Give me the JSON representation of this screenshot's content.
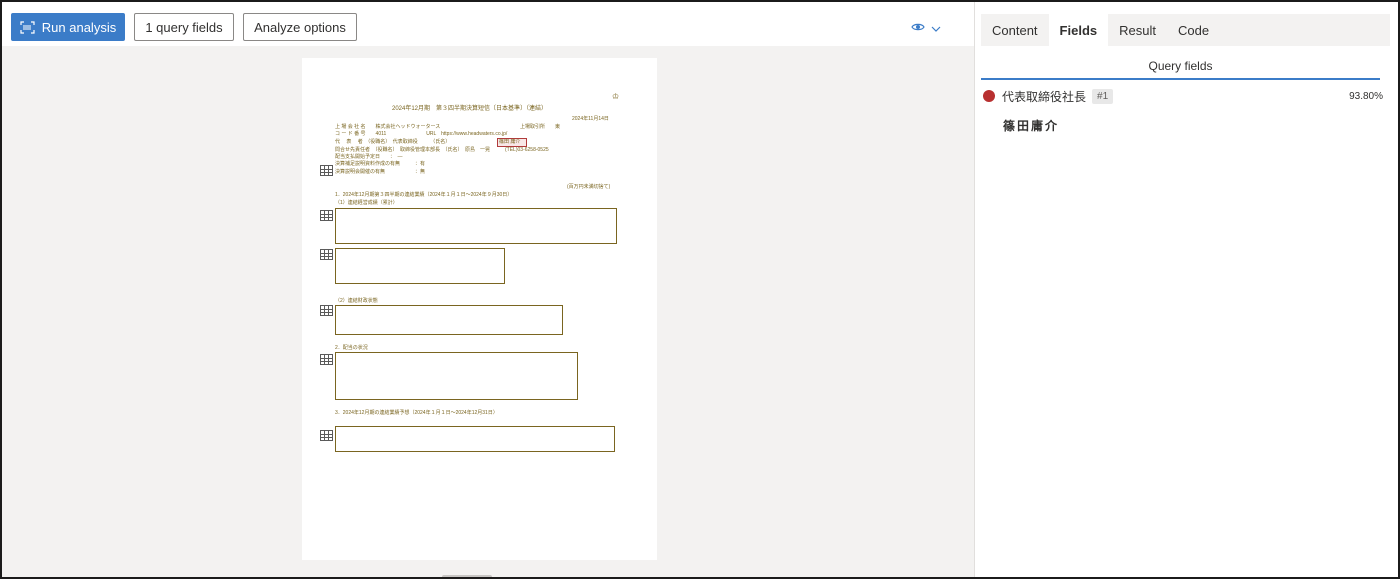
{
  "toolbar": {
    "run_label": "Run analysis",
    "query_label": "1 query fields",
    "analyze_label": "Analyze options"
  },
  "panel": {
    "tabs": [
      "Content",
      "Fields",
      "Result",
      "Code"
    ],
    "active_tab": "Fields",
    "section_title": "Query fields",
    "field": {
      "name": "代表取締役社長",
      "badge": "#1",
      "confidence": "93.80%",
      "value": "篠田庸介",
      "color": "#b83030"
    }
  },
  "document": {
    "title": "2024年12月期　第３四半期決算短信〔日本基準〕（連結）",
    "date": "2024年11月14日",
    "company": "上 場 会 社 名　　株式会社ヘッドウォータース",
    "exchange": "上場取引所　　東",
    "code": "コ ー ド 番 号　　4011　　　　　　　　URL　https://www.headwaters.co.jp/",
    "rep": "代　 表 　者　（役職名）　代表取締役　　　（氏名）",
    "rep_name": "篠田 庸介",
    "contact": "問合せ先責任者　（役職名）　取締役管理本部長　（氏名）　原島　一晃　　　(TEL)03-6258-0525",
    "div_date": "配当支払開始予定日　　：　―",
    "supp": "決算補足説明資料作成の有無　　　：有",
    "meeting": "決算説明会開催の有無　　　　　　：無",
    "rounding": "(百万円未満切捨て)",
    "sec1": "1．2024年12月期第３四半期の連結業績（2024年１月１日～2024年９月30日）",
    "sec1_1": "（1）連結経営成績（累計）",
    "sec1_2": "（2）連結財政状態",
    "sec2": "2．配当の状況",
    "sec3": "3．2024年12月期の連結業績予想（2024年１月１日～2024年12月31日）"
  }
}
